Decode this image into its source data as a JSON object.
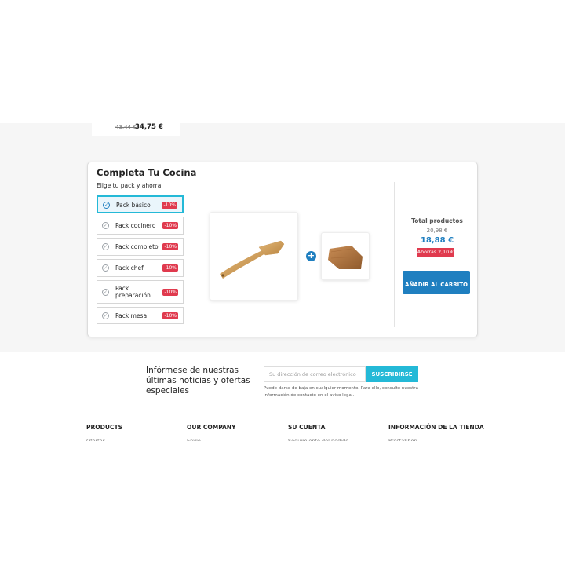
{
  "top_product": {
    "old_price": "43,44 €",
    "new_price": "34,75 €"
  },
  "pack": {
    "title": "Completa Tu Cocina",
    "subtitle": "Elige tu pack y ahorra",
    "options": [
      {
        "label": "Pack básico",
        "discount": "-10%",
        "selected": true
      },
      {
        "label": "Pack cocinero",
        "discount": "-10%",
        "selected": false
      },
      {
        "label": "Pack completo",
        "discount": "-10%",
        "selected": false
      },
      {
        "label": "Pack chef",
        "discount": "-10%",
        "selected": false
      },
      {
        "label": "Pack preparación",
        "discount": "-10%",
        "selected": false
      },
      {
        "label": "Pack mesa",
        "discount": "-10%",
        "selected": false
      }
    ],
    "plus_symbol": "+",
    "total_label": "Total productos",
    "total_old": "20,98 €",
    "total_new": "18,88 €",
    "savings": "Ahorras 2,10 €",
    "add_to_cart": "AÑADIR AL CARRITO"
  },
  "newsletter": {
    "text": "Infórmese de nuestras últimas noticias y ofertas especiales",
    "placeholder": "Su dirección de correo electrónico",
    "button": "SUSCRIBIRSE",
    "note": "Puede darse de baja en cualquier momento. Para ello, consulte nuestra información de contacto en el aviso legal."
  },
  "footer": {
    "columns": [
      {
        "heading": "PRODUCTS",
        "first_link": "Ofertas"
      },
      {
        "heading": "OUR COMPANY",
        "first_link": "Envío"
      },
      {
        "heading": "SU CUENTA",
        "first_link": "Seguimiento del pedido"
      },
      {
        "heading": "INFORMACIÓN DE LA TIENDA",
        "first_link": "PrestaShop"
      }
    ]
  },
  "colors": {
    "accent_blue": "#1f7fc0",
    "cyan": "#24b9d7",
    "discount_red": "#e03a4e",
    "gray_bg": "#f6f6f6"
  },
  "icons": [
    "radio-check-icon",
    "plus-icon"
  ]
}
